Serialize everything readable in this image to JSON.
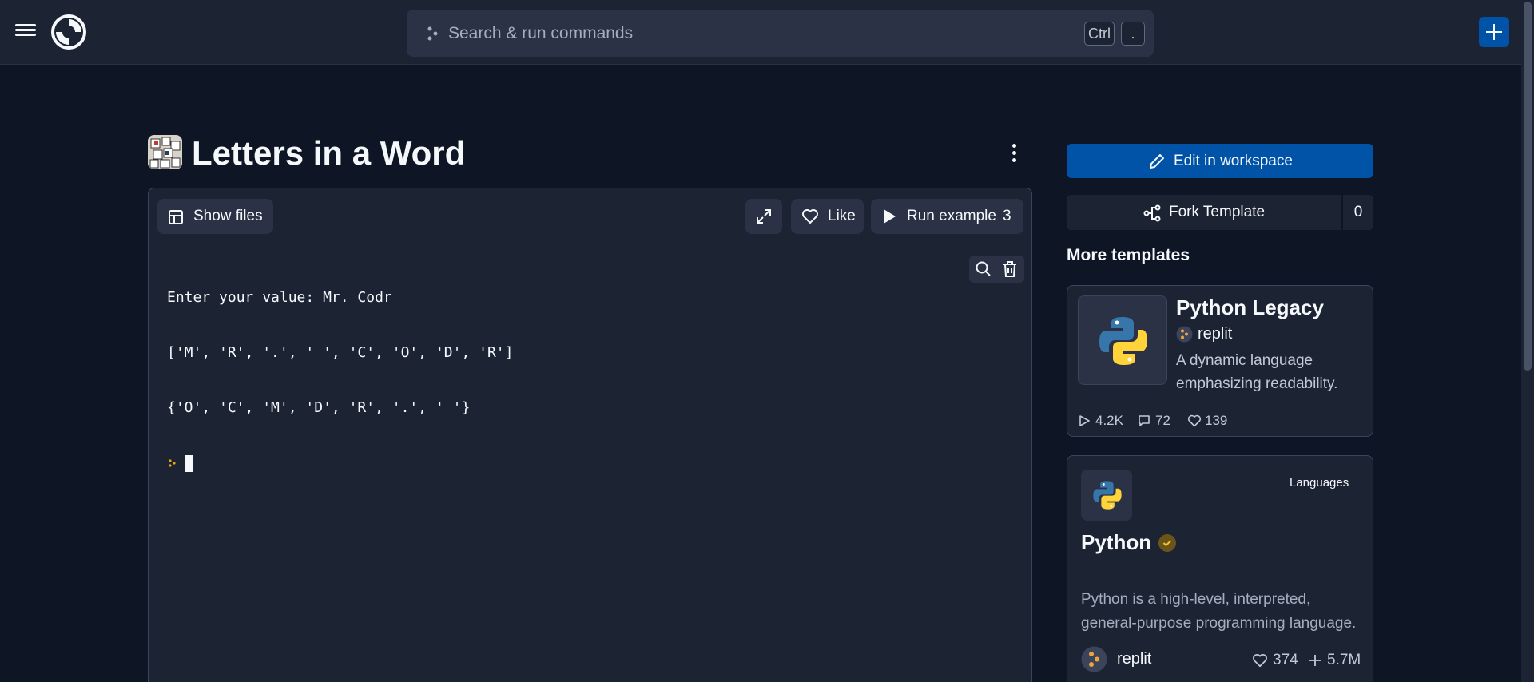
{
  "header": {
    "search_placeholder": "Search & run commands",
    "shortcut_keys": [
      "Ctrl",
      "."
    ]
  },
  "page": {
    "title": "Letters in a Word"
  },
  "repl": {
    "show_files_label": "Show files",
    "like_label": "Like",
    "run_label": "Run example",
    "run_count": "3",
    "console_lines": [
      "Enter your value: Mr. Codr",
      "['M', 'R', '.', ' ', 'C', 'O', 'D', 'R']",
      "{'O', 'C', 'M', 'D', 'R', '.', ' '}"
    ]
  },
  "sidebar": {
    "edit_label": "Edit in workspace",
    "fork_label": "Fork Template",
    "fork_count": "0",
    "more_templates_heading": "More templates",
    "templates": [
      {
        "name": "Python Legacy",
        "author": "replit",
        "description": "A dynamic language emphasizing readability.",
        "runs": "4.2K",
        "comments": "72",
        "likes": "139"
      },
      {
        "category": "Languages",
        "name": "Python",
        "description": "Python is a high-level, interpreted, general-purpose programming language.",
        "author": "replit",
        "likes": "374",
        "forks": "5.7M"
      }
    ]
  },
  "colors": {
    "background": "#0e1525",
    "surface": "#1c2333",
    "primary": "#0053a6"
  }
}
